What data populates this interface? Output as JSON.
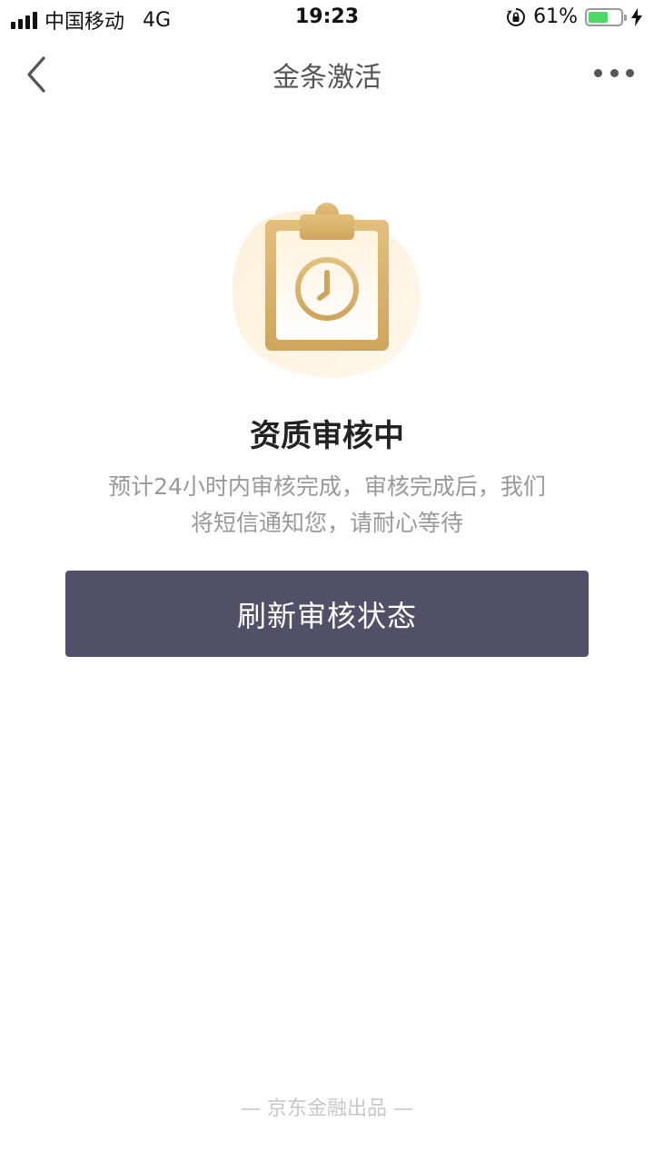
{
  "status_bar": {
    "carrier": "中国移动",
    "network": "4G",
    "time": "19:23",
    "battery_percent": "61%",
    "battery_level": 0.61
  },
  "nav": {
    "title": "金条激活"
  },
  "review": {
    "title": "资质审核中",
    "description": "预计24小时内审核完成，审核完成后，我们将短信通知您，请耐心等待"
  },
  "actions": {
    "refresh_label": "刷新审核状态"
  },
  "footer": {
    "text": "— 京东金融出品 —"
  },
  "colors": {
    "button_bg": "#505168",
    "gold": "#d9b36a",
    "battery_green": "#4cd964"
  },
  "icons": {
    "back": "chevron-left-icon",
    "more": "more-dots-icon",
    "illustration": "clipboard-clock-icon",
    "lock": "rotation-lock-icon",
    "charging": "bolt-icon"
  }
}
